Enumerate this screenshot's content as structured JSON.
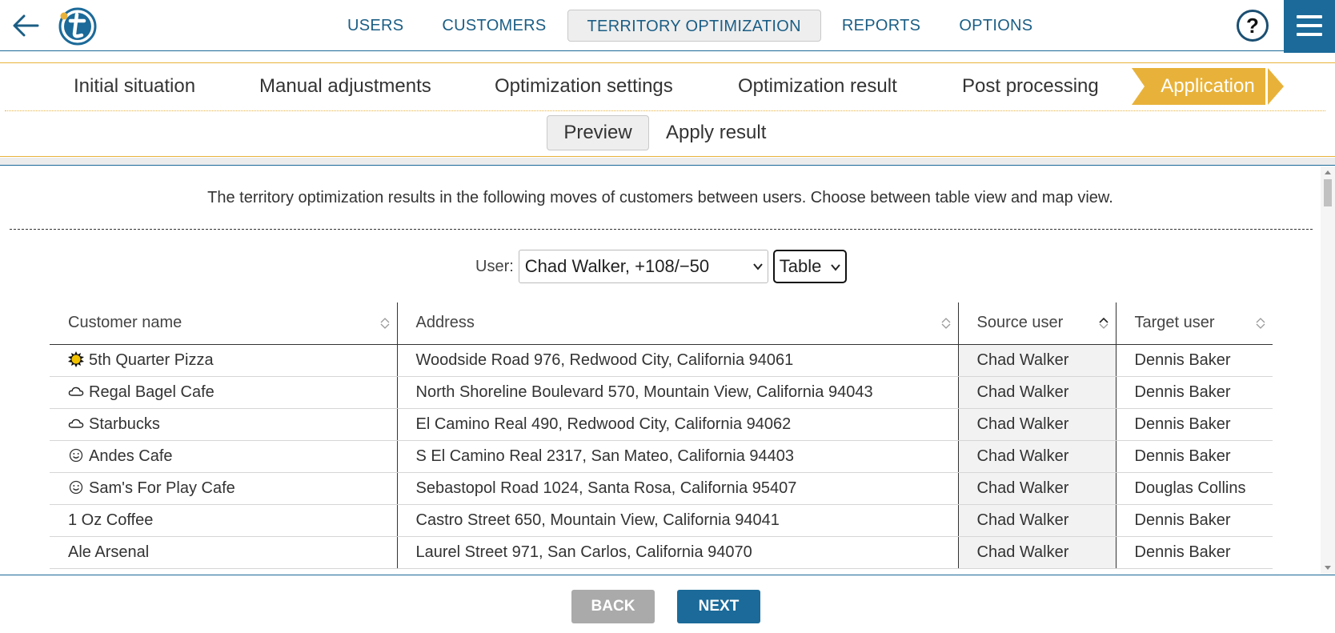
{
  "nav": {
    "items": [
      {
        "label": "USERS",
        "active": false
      },
      {
        "label": "CUSTOMERS",
        "active": false
      },
      {
        "label": "TERRITORY OPTIMIZATION",
        "active": true
      },
      {
        "label": "REPORTS",
        "active": false
      },
      {
        "label": "OPTIONS",
        "active": false
      }
    ],
    "help_label": "?"
  },
  "steps": {
    "items": [
      "Initial situation",
      "Manual adjustments",
      "Optimization settings",
      "Optimization result",
      "Post processing"
    ],
    "active": "Application"
  },
  "substeps": {
    "preview": "Preview",
    "apply": "Apply result"
  },
  "content": {
    "intro": "The territory optimization results in the following moves of customers between users. Choose between table view and map view.",
    "user_label": "User:",
    "user_value": "Chad Walker, +108/−50",
    "view_value": "Table"
  },
  "table": {
    "headers": [
      "Customer name",
      "Address",
      "Source user",
      "Target user"
    ],
    "rows": [
      {
        "icon": "sun",
        "name": "5th Quarter Pizza",
        "address": "Woodside Road 976, Redwood City, California 94061",
        "source": "Chad Walker",
        "target": "Dennis Baker"
      },
      {
        "icon": "cloud",
        "name": "Regal Bagel Cafe",
        "address": "North Shoreline Boulevard 570, Mountain View, California 94043",
        "source": "Chad Walker",
        "target": "Dennis Baker"
      },
      {
        "icon": "cloud",
        "name": "Starbucks",
        "address": "El Camino Real 490, Redwood City, California 94062",
        "source": "Chad Walker",
        "target": "Dennis Baker"
      },
      {
        "icon": "smiley",
        "name": "Andes Cafe",
        "address": "S El Camino Real 2317, San Mateo, California 94403",
        "source": "Chad Walker",
        "target": "Dennis Baker"
      },
      {
        "icon": "smiley",
        "name": "Sam's For Play Cafe",
        "address": "Sebastopol Road 1024, Santa Rosa, California 95407",
        "source": "Chad Walker",
        "target": "Douglas Collins"
      },
      {
        "icon": "",
        "name": "1 Oz Coffee",
        "address": "Castro Street 650, Mountain View, California 94041",
        "source": "Chad Walker",
        "target": "Dennis Baker"
      },
      {
        "icon": "",
        "name": "Ale Arsenal",
        "address": "Laurel Street 971, San Carlos, California 94070",
        "source": "Chad Walker",
        "target": "Dennis Baker"
      }
    ]
  },
  "footer": {
    "back": "BACK",
    "next": "NEXT"
  },
  "colors": {
    "brand": "#1b6a99",
    "accent": "#e8b23a",
    "disabled": "#aaaaaa"
  }
}
